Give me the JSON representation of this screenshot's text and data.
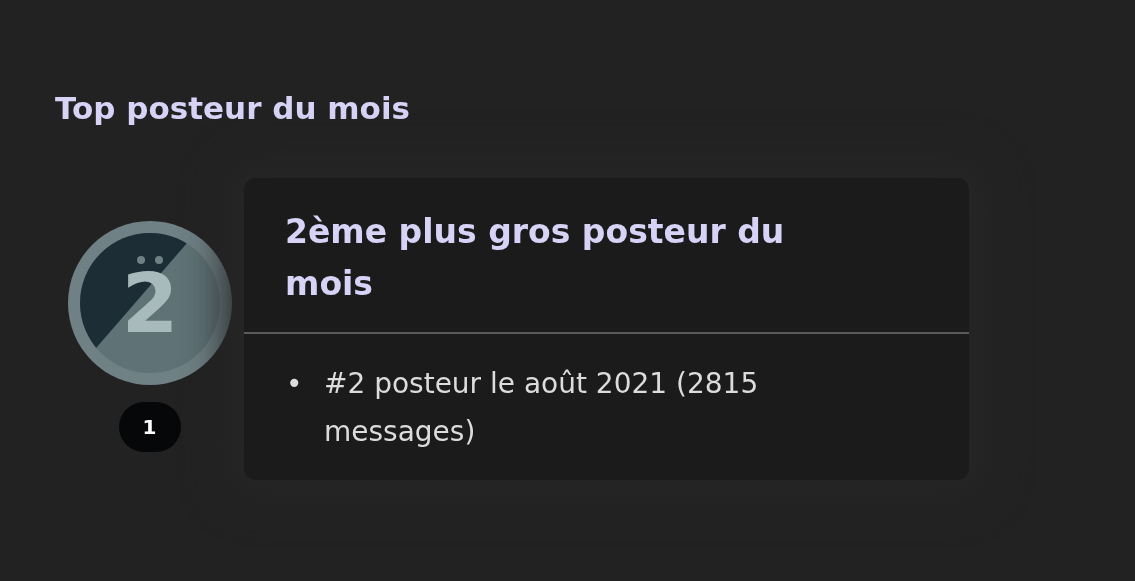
{
  "section_title": "Top posteur du mois",
  "trophy": {
    "medal_label": "2",
    "count": "1"
  },
  "card": {
    "title": "2ème plus gros posteur du mois",
    "items": [
      {
        "bullet": "•",
        "text": "#2 posteur le août 2021 (2815 messages)"
      }
    ]
  }
}
